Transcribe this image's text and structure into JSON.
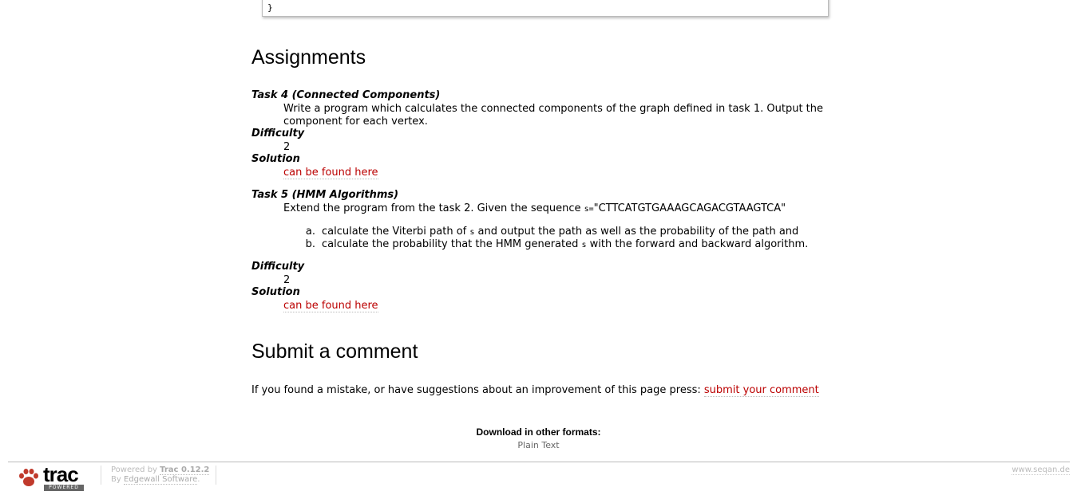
{
  "code_block": {
    "closing_brace": "}"
  },
  "assignments": {
    "heading": "Assignments",
    "tasks": [
      {
        "title": "Task 4 (Connected Components)",
        "description_line1": "Write a program which calculates the connected components of the graph defined in task 1. Output the",
        "description_line2": "component for each vertex.",
        "difficulty_label": "Difficulty",
        "difficulty": "2",
        "solution_label": "Solution",
        "solution_link": "can be found here"
      },
      {
        "title": "Task 5 (HMM Algorithms)",
        "description_prefix": "Extend the program from the task 2. Given the sequence ",
        "description_code": "s=",
        "description_seq": "\"CTTCATGTGAAAGCAGACGTAAGTCA\"",
        "items": [
          {
            "marker": "a.",
            "pre": "calculate the Viterbi path of ",
            "code": "s",
            "post": " and output the path as well as the probability of the path and"
          },
          {
            "marker": "b.",
            "pre": "calculate the probability that the HMM generated ",
            "code": "s",
            "post": " with the forward and backward algorithm."
          }
        ],
        "difficulty_label": "Difficulty",
        "difficulty": "2",
        "solution_label": "Solution",
        "solution_link": "can be found here"
      }
    ]
  },
  "comment": {
    "heading": "Submit a comment",
    "text": "If you found a mistake, or have suggestions about an improvement of this page press: ",
    "link": "submit your comment"
  },
  "download": {
    "title": "Download in other formats:",
    "plain_text": "Plain Text"
  },
  "footer": {
    "logo_text": "trac",
    "logo_sub": "POWERED",
    "powered_by": "Powered by ",
    "trac_version": "Trac 0.12.2",
    "by": "By ",
    "edgewall": "Edgewall Software",
    "period": ".",
    "site": "www.seqan.de"
  },
  "colors": {
    "link": "#bb0000",
    "logo": "#c0392b"
  }
}
